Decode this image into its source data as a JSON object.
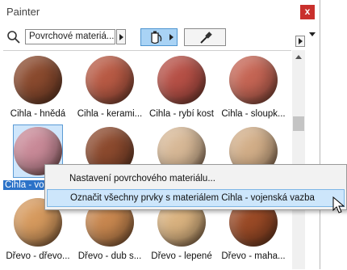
{
  "window": {
    "title": "Painter",
    "close_label": "x"
  },
  "toolbar": {
    "material_value": "Povrchové materiá...",
    "icons": [
      "search-icon",
      "paint-bucket-icon",
      "eyedropper-icon"
    ]
  },
  "materials": [
    {
      "label": "Cihla - hnědá",
      "color": "#8a4a2e"
    },
    {
      "label": "Cihla - kerami...",
      "color": "#b85a44"
    },
    {
      "label": "Cihla - rybí kost",
      "color": "#b65046"
    },
    {
      "label": "Cihla - sloupk...",
      "color": "#c56554"
    },
    {
      "label": "Cihla - vojenská vazba",
      "color": "#c98a98",
      "selected": true
    },
    {
      "label": "",
      "color": "#8c4a2e"
    },
    {
      "label": "",
      "color": "#d7b896"
    },
    {
      "label": "",
      "color": "#d2ae88"
    },
    {
      "label": "Dřevo - dřevo...",
      "color": "#d69a5e"
    },
    {
      "label": "Dřevo - dub s...",
      "color": "#c8874f"
    },
    {
      "label": "Dřevo - lepené",
      "color": "#d9b27f"
    },
    {
      "label": "Dřevo - maha...",
      "color": "#9a4a26"
    }
  ],
  "context_menu": {
    "items": [
      {
        "label": "Nastavení povrchového materiálu..."
      },
      {
        "label": "Označit všechny prvky s materiálem Cihla - vojenská vazba",
        "hover": true
      }
    ]
  }
}
